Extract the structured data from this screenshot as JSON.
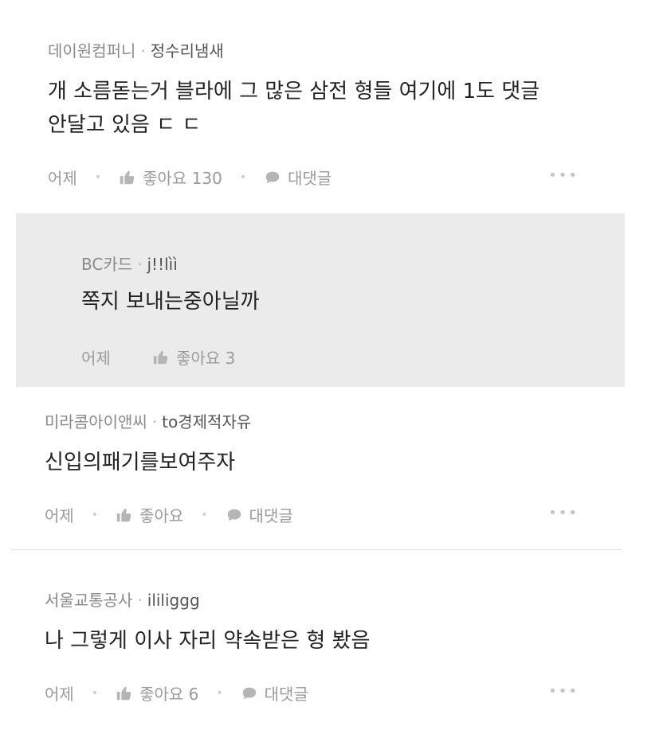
{
  "comments": [
    {
      "company": "데이원컴퍼니",
      "nickname": "정수리냄새",
      "lines": [
        "개 소름돋는거 블라에 그 많은 삼전 형들 여기에 1도 댓글",
        "안달고 있음 ㄷ ㄷ"
      ],
      "time": "어제",
      "like_label": "좋아요 130",
      "reply_label": "대댓글",
      "more": "•••"
    },
    {
      "company": "BC카드",
      "nickname": "j!!lìì",
      "lines": [
        "쪽지 보내는중아닐까"
      ],
      "time": "어제",
      "like_label": "좋아요 3"
    },
    {
      "company": "미라콤아이앤씨",
      "nickname": "to경제적자유",
      "lines": [
        "신입의패기를보여주자"
      ],
      "time": "어제",
      "like_label": "좋아요",
      "reply_label": "대댓글",
      "more": "•••"
    },
    {
      "company": "서울교통공사",
      "nickname": "ililiggg",
      "lines": [
        "나 그렇게 이사 자리 약속받은 형 봤음"
      ],
      "time": "어제",
      "like_label": "좋아요 6",
      "reply_label": "대댓글",
      "more": "•••"
    }
  ],
  "colors": {
    "reply_background": "#ebebeb",
    "meta_text": "#8a8a8a",
    "body_text": "#222222"
  },
  "icons": {
    "like": "thumbs-up-icon",
    "reply": "speech-bubble-icon",
    "more": "more-dots-icon"
  }
}
